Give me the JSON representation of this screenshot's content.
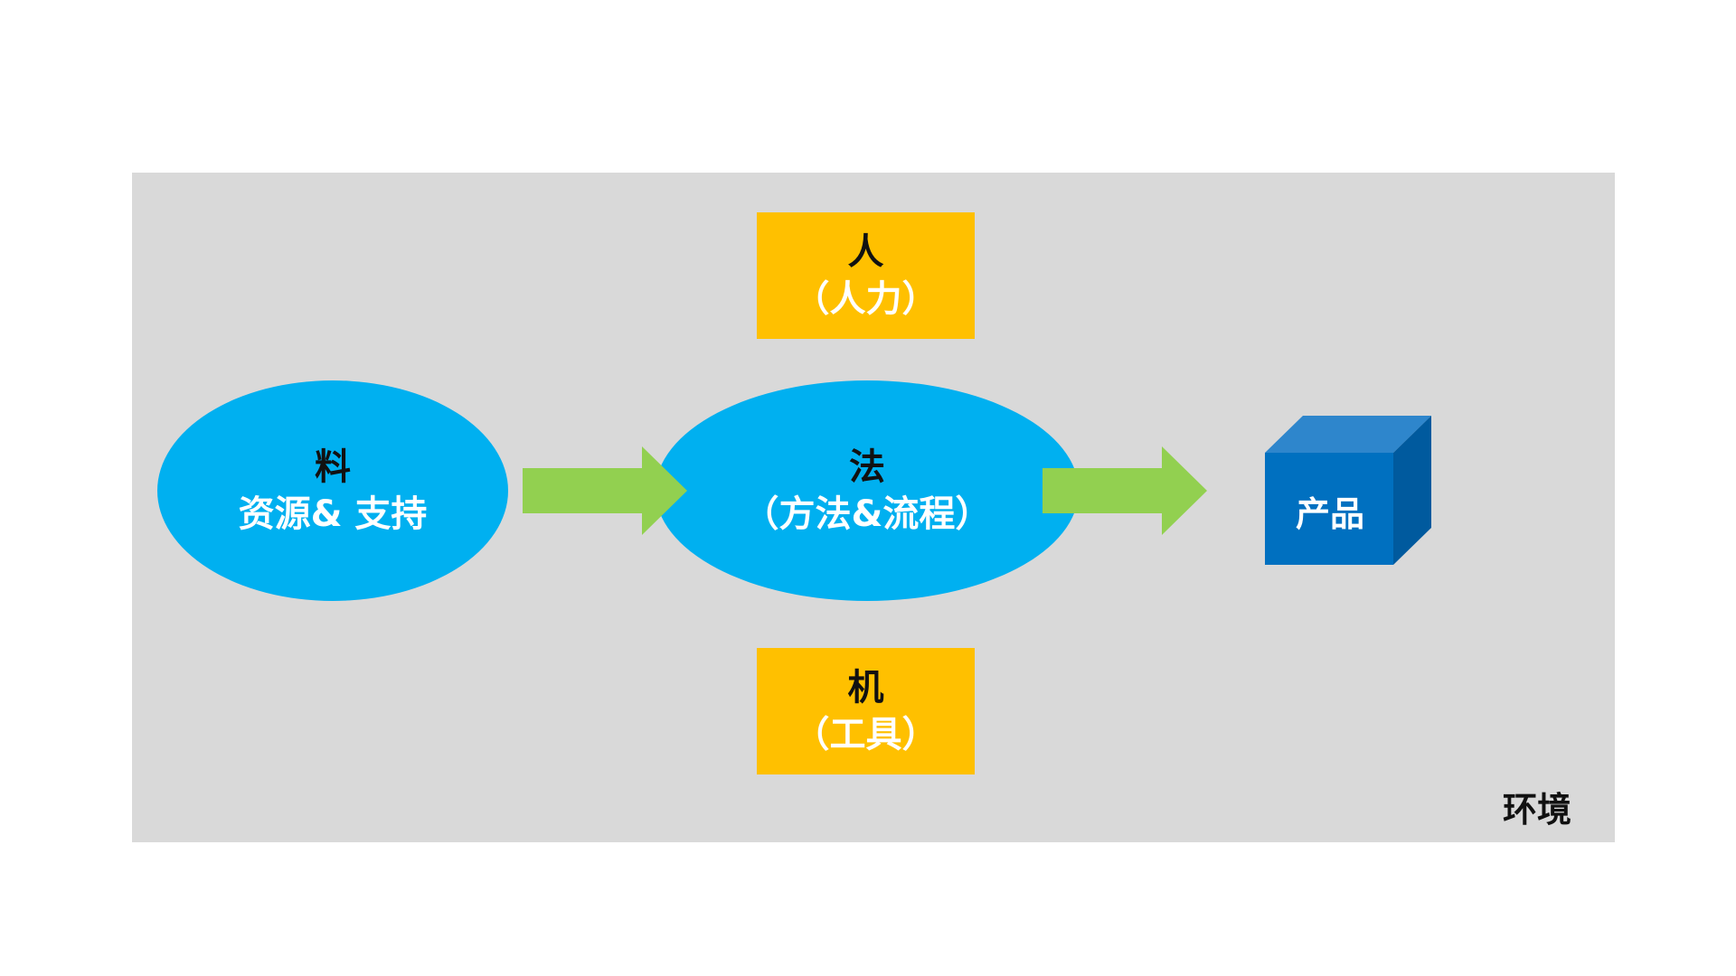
{
  "colors": {
    "background": "#ffffff",
    "panel": "#d9d9d9",
    "box": "#ffc000",
    "ellipse": "#00b0f0",
    "arrow": "#92d050",
    "cube_front": "#0070c0",
    "cube_top": "#2e86cc",
    "cube_side": "#005a9e"
  },
  "people": {
    "title": "人",
    "subtitle": "（人力）"
  },
  "machine": {
    "title": "机",
    "subtitle": "（工具）"
  },
  "material": {
    "title": "料",
    "subtitle": "资源& 支持"
  },
  "method": {
    "title": "法",
    "subtitle": "（方法&流程）"
  },
  "product": {
    "label": "产品"
  },
  "environment": {
    "label": "环境"
  }
}
